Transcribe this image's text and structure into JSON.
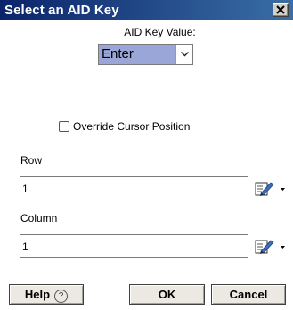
{
  "window": {
    "title": "Select an AID Key",
    "close_label": "x"
  },
  "aid_key": {
    "label": "AID Key Value:",
    "selected": "Enter"
  },
  "override": {
    "label": "Override Cursor Position",
    "checked": false
  },
  "row": {
    "label": "Row",
    "value": "1"
  },
  "column": {
    "label": "Column",
    "value": "1"
  },
  "buttons": {
    "help": "Help",
    "help_icon": "?",
    "ok": "OK",
    "cancel": "Cancel"
  },
  "colors": {
    "titlebar": "#0a246a",
    "selected_value_bg": "#9aa6d8"
  },
  "icons": {
    "edit": "edit-pencil-icon",
    "dropdown": "chevron-down-icon",
    "close": "close-icon"
  }
}
